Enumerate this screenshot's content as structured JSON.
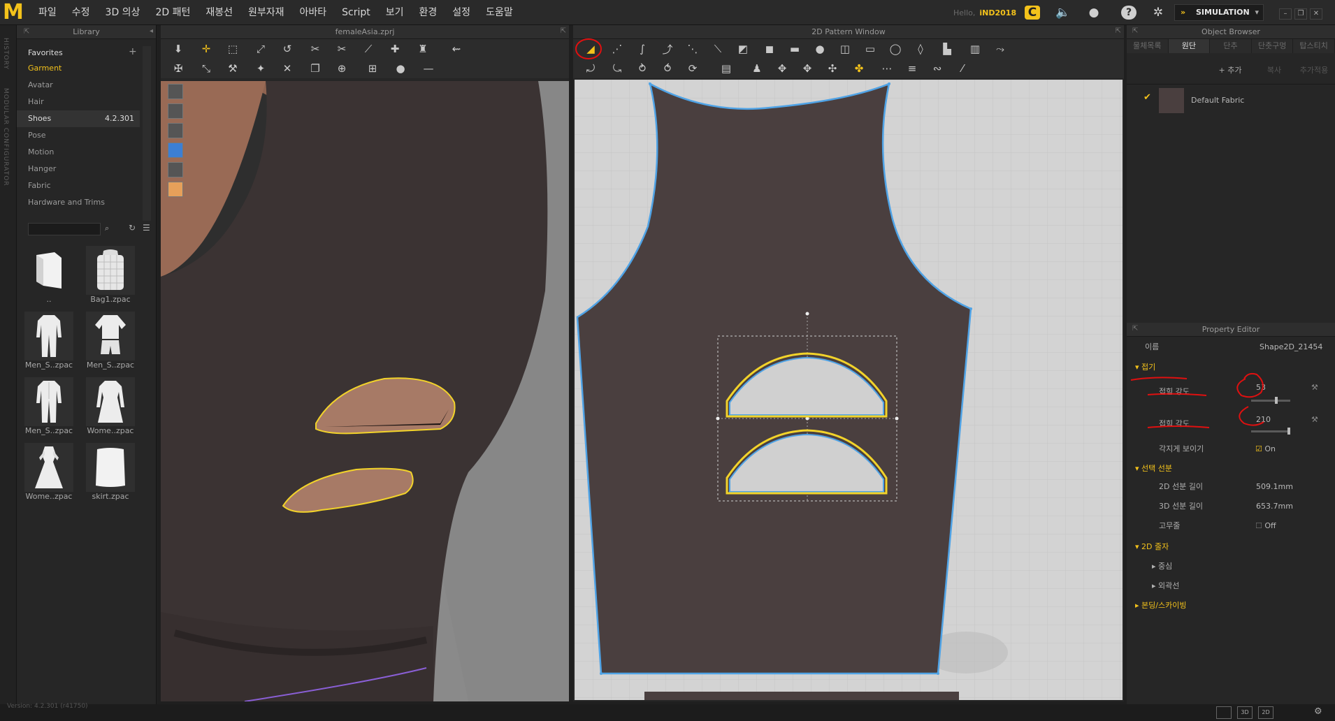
{
  "menu": {
    "items": [
      "파일",
      "수정",
      "3D 의상",
      "2D 패턴",
      "재봉선",
      "원부자재",
      "아바타",
      "Script",
      "보기",
      "환경",
      "설정",
      "도움말"
    ],
    "hello": "Hello,",
    "user": "iND2018",
    "simulation": "SIMULATION"
  },
  "sidebar": {
    "history": "HISTORY",
    "configurator": "MODULAR CONFIGURATOR"
  },
  "library": {
    "title": "Library",
    "items": [
      {
        "label": "Favorites"
      },
      {
        "label": "Garment"
      },
      {
        "label": "Avatar"
      },
      {
        "label": "Hair"
      },
      {
        "label": "Shoes",
        "badge": "4.2.301"
      },
      {
        "label": "Pose"
      },
      {
        "label": "Motion"
      },
      {
        "label": "Hanger"
      },
      {
        "label": "Fabric"
      },
      {
        "label": "Hardware and Trims"
      }
    ],
    "files": [
      {
        "name": "..",
        "icon": "folder-icon"
      },
      {
        "name": "Bag1.zpac",
        "icon": "bag-icon"
      },
      {
        "name": "Men_S..zpac",
        "icon": "suit-icon"
      },
      {
        "name": "Men_S..zpac",
        "icon": "shirt-shorts-icon"
      },
      {
        "name": "Men_S..zpac",
        "icon": "suit-icon"
      },
      {
        "name": "Wome..zpac",
        "icon": "dress-icon"
      },
      {
        "name": "Wome..zpac",
        "icon": "dress-icon"
      },
      {
        "name": "skirt.zpac",
        "icon": "skirt-icon"
      }
    ]
  },
  "view3d": {
    "title": "femaleAsia.zprj"
  },
  "view2d": {
    "title": "2D Pattern Window"
  },
  "objectBrowser": {
    "title": "Object Browser",
    "tabs": [
      "물체목록",
      "원단",
      "단추",
      "단춧구멍",
      "탑스티치"
    ],
    "activeTab": 1,
    "actions": [
      "+ 추가",
      "복사",
      "추가적용"
    ],
    "fabric": "Default Fabric"
  },
  "propertyEditor": {
    "title": "Property Editor",
    "nameLabel": "이름",
    "nameValue": "Shape2D_21454",
    "fold": {
      "header": "접기",
      "strengthLabel": "접힘 강도",
      "strengthValue": "53",
      "angleLabel": "접힘 각도",
      "angleValue": "210",
      "sharpLabel": "각지게 보이기",
      "sharpValue": "On"
    },
    "selectedLine": {
      "header": "선택 선분",
      "len2dLabel": "2D 선분 길이",
      "len2dValue": "509.1mm",
      "len3dLabel": "3D 선분 길이",
      "len3dValue": "653.7mm",
      "elasticLabel": "고무줄",
      "elasticValue": "Off"
    },
    "arrangement": {
      "header": "2D 줄자",
      "center": "중심",
      "outline": "외곽선"
    },
    "bonding": {
      "header": "본딩/스카이빙"
    }
  },
  "status": {
    "version": "Version: 4.2.301 (r41750)"
  },
  "colors": {
    "accent": "#f3c21b",
    "garment": "#4a3f3f",
    "outline": "#f2d32a",
    "patternEdge": "#4fa3e6",
    "annotation": "#e01010"
  }
}
